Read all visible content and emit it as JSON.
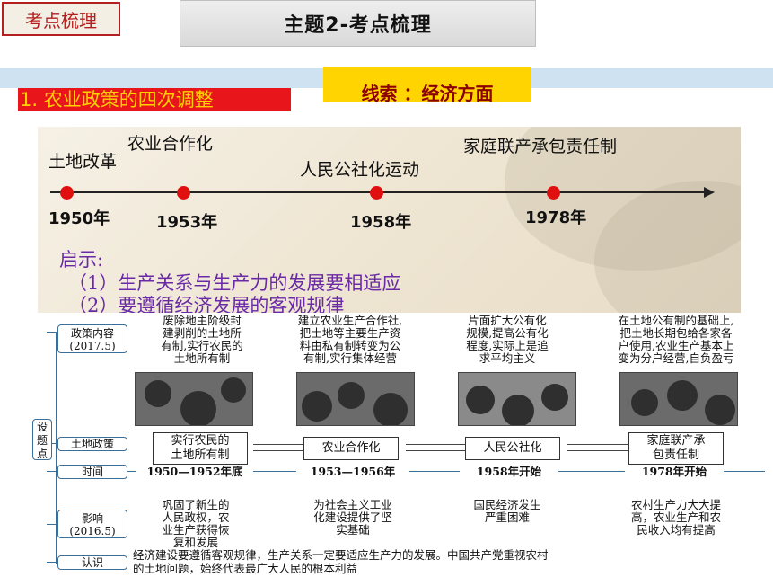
{
  "header": {
    "tag": "考点梳理",
    "title": "主题2-考点梳理",
    "section": "1. 农业政策的四次调整",
    "clue": "线索    ：经济方面"
  },
  "timeline": {
    "events": [
      "土地改革",
      "农业合作化",
      "人民公社化运动",
      "家庭联产承包责任制"
    ],
    "years": [
      "1950年",
      "1953年",
      "1958年",
      "1978年"
    ],
    "insight_title": "启示:",
    "insights": [
      "（1）生产关系与生产力的发展要相适应",
      "（2）要遵循经济发展的客观规律"
    ]
  },
  "table": {
    "side_label": "设题点",
    "row_labels": {
      "policy": "政策内容",
      "policy_year": "(2017.5)",
      "land": "土地政策",
      "time": "时间",
      "impact": "影响",
      "impact_year": "(2016.5)",
      "recognition": "认识"
    },
    "policy_content": [
      "废除地主阶级封\n建剥削的土地所\n有制,实行农民的\n土地所有制",
      "建立农业生产合作社,\n把土地等主要生产资\n料由私有制转变为公\n有制,实行集体经营",
      "片面扩大公有化\n规模,提高公有化\n程度,实际上是追\n求平均主义",
      "在土地公有制的基础上,\n把土地长期包给各家各\n户使用,农业生产基本上\n变为分户经营,自负盈亏"
    ],
    "land_policies": [
      "实行农民的\n土地所有制",
      "农业合作化",
      "人民公社化",
      "家庭联产承\n包责任制"
    ],
    "times": [
      "1950—1952年底",
      "1953—1956年",
      "1958年开始",
      "1978年开始"
    ],
    "impacts": [
      "巩固了新生的\n人民政权，农\n业生产获得恢\n复和发展",
      "为社会主义工业\n化建设提供了坚\n实基础",
      "国民经济发生\n严重困难",
      "农村生产力大大提\n高，农业生产和农\n民收入均有提高"
    ],
    "recognition_lines": [
      "经济建设要遵循客观规律，生产关系一定要适应生产力的发展。中国共产党重视农村",
      "的土地问题，始终代表最广大人民的根本利益"
    ]
  }
}
